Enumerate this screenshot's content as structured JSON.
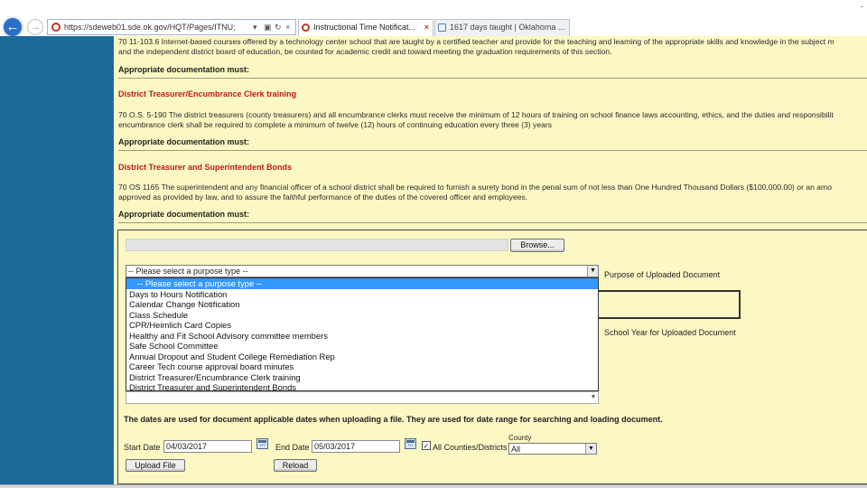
{
  "browser": {
    "url": "https://sdeweb01.sde.ok.gov/HQT/Pages/ITNU;",
    "tabs": [
      {
        "title": "Instructional Time Notificat...",
        "close": "×"
      },
      {
        "title": "1617 days taught | Oklahoma ..."
      }
    ],
    "window_control": "-",
    "colors": {
      "accent": "#2d6ec9"
    }
  },
  "sections": [
    {
      "text_lines": [
        "70 11-103.6 Internet-based courses offered by a technology center school that are taught by a certified teacher and provide for the teaching and learning of the appropriate skills and knowledge in the subject m",
        "and the independent district board of education, be counted for academic credit and toward meeting the graduation requirements of this section."
      ],
      "doc_label": "Appropriate documentation must:"
    },
    {
      "heading": "District Treasurer/Encumbrance Clerk training",
      "text_lines": [
        "70 O.S. 5-190 The district treasurers (county treasurers) and all encumbrance clerks must receive the minimum of 12 hours of training on school finance laws accounting, ethics, and the duties and responsibilit",
        "encumbrance clerk shall be required to complete a minimum of twelve (12) hours of continuing education every three (3) years"
      ],
      "doc_label": "Appropriate documentation must:"
    },
    {
      "heading": "District Treasurer and Superintendent Bonds",
      "text_lines": [
        "70 OS 1165 The superintendent and any financial officer of a school district shall be required to furnish a surety bond in the penal sum of not less than One Hundred Thousand Dollars ($100,000.00) or an amo",
        "approved as provided by law, and to assure the faithful performance of the duties of the covered officer and employees."
      ],
      "doc_label": "Appropriate documentation must:"
    }
  ],
  "form": {
    "browse_label": "Browse...",
    "purpose_selected": "-- Please select a purpose type --",
    "purpose_label": "Purpose of Uploaded Document",
    "school_year_label": "School Year for Uploaded Document",
    "purpose_options": [
      "-- Please select a purpose type --",
      "Days to Hours Notification",
      "Calendar Change Notification",
      "Class Schedule",
      "CPR/Heimlich Card Copies",
      "Healthy and Fit School Advisory committee members",
      "Safe School Committee",
      "Annual Dropout and Student College Remediation Rep",
      "Career Tech course approval board minutes",
      "District Treasurer/Encumbrance Clerk training",
      "District Treasurer and Superintendent Bonds"
    ],
    "dates_note": "The dates are used for document applicable dates when uploading a file. They are used for date range for searching and loading document.",
    "start_date_label": "Start Date",
    "start_date": "04/03/2017",
    "end_date_label": "End Date",
    "end_date": "05/03/2017",
    "all_counties_label": "All Counties/Districts",
    "all_counties_checked": "✓",
    "county_label": "County",
    "county_value": "All",
    "upload_label": "Upload File",
    "reload_label": "Reload"
  },
  "icons": [
    "back-arrow-icon",
    "forward-icon",
    "favicon-icon",
    "search-dropdown-icon",
    "lock-icon",
    "refresh-icon",
    "close-icon",
    "calendar-icon",
    "dropdown-arrow-icon"
  ],
  "colors": {
    "rail": "#1d6a9a",
    "page_bg": "#fbf8c4",
    "heading": "#c01b1b",
    "option_selected": "#3399ff"
  }
}
